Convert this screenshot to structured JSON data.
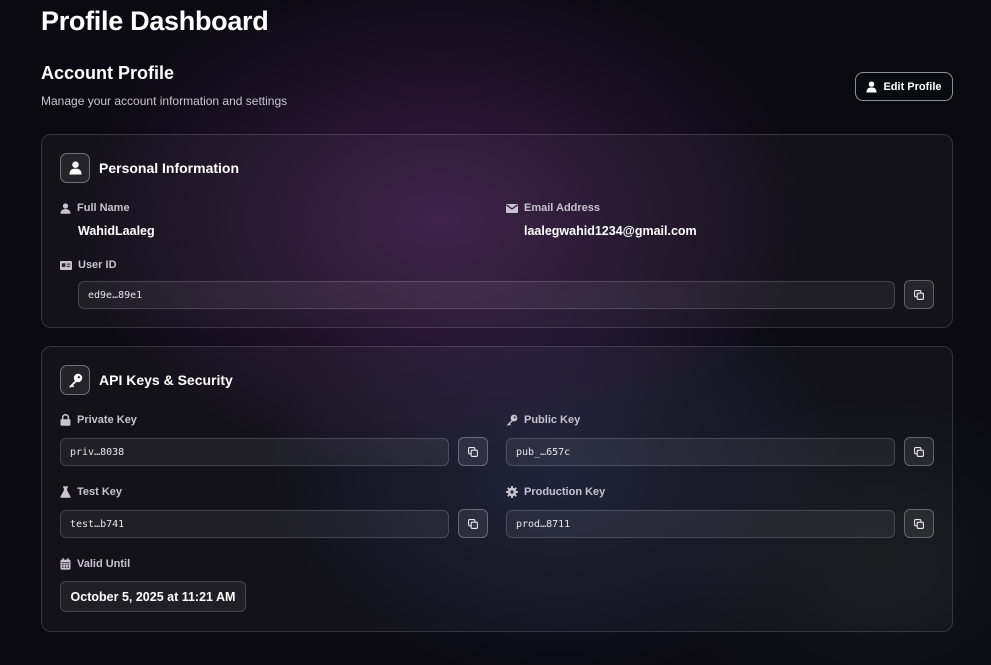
{
  "page": {
    "title": "Profile Dashboard"
  },
  "section": {
    "title": "Account Profile",
    "subtitle": "Manage your account information and settings",
    "edit_button": "Edit Profile"
  },
  "personal": {
    "title": "Personal Information",
    "full_name_label": "Full Name",
    "full_name": "WahidLaaleg",
    "email_label": "Email Address",
    "email": "laalegwahid1234@gmail.com",
    "user_id_label": "User ID",
    "user_id": "ed9e…89e1"
  },
  "api": {
    "title": "API Keys & Security",
    "private_key_label": "Private Key",
    "private_key": "priv…8038",
    "public_key_label": "Public Key",
    "public_key": "pub_…657c",
    "test_key_label": "Test Key",
    "test_key": "test…b741",
    "production_key_label": "Production Key",
    "production_key": "prod…8711",
    "valid_until_label": "Valid Until",
    "valid_until": "October 5, 2025 at 11:21 AM"
  },
  "icons": {
    "user": "user-icon",
    "mail": "mail-icon",
    "id_card": "id-card-icon",
    "key": "key-icon",
    "lock": "lock-icon",
    "flask": "flask-icon",
    "gear": "gear-icon",
    "calendar": "calendar-icon",
    "copy": "copy-icon"
  }
}
